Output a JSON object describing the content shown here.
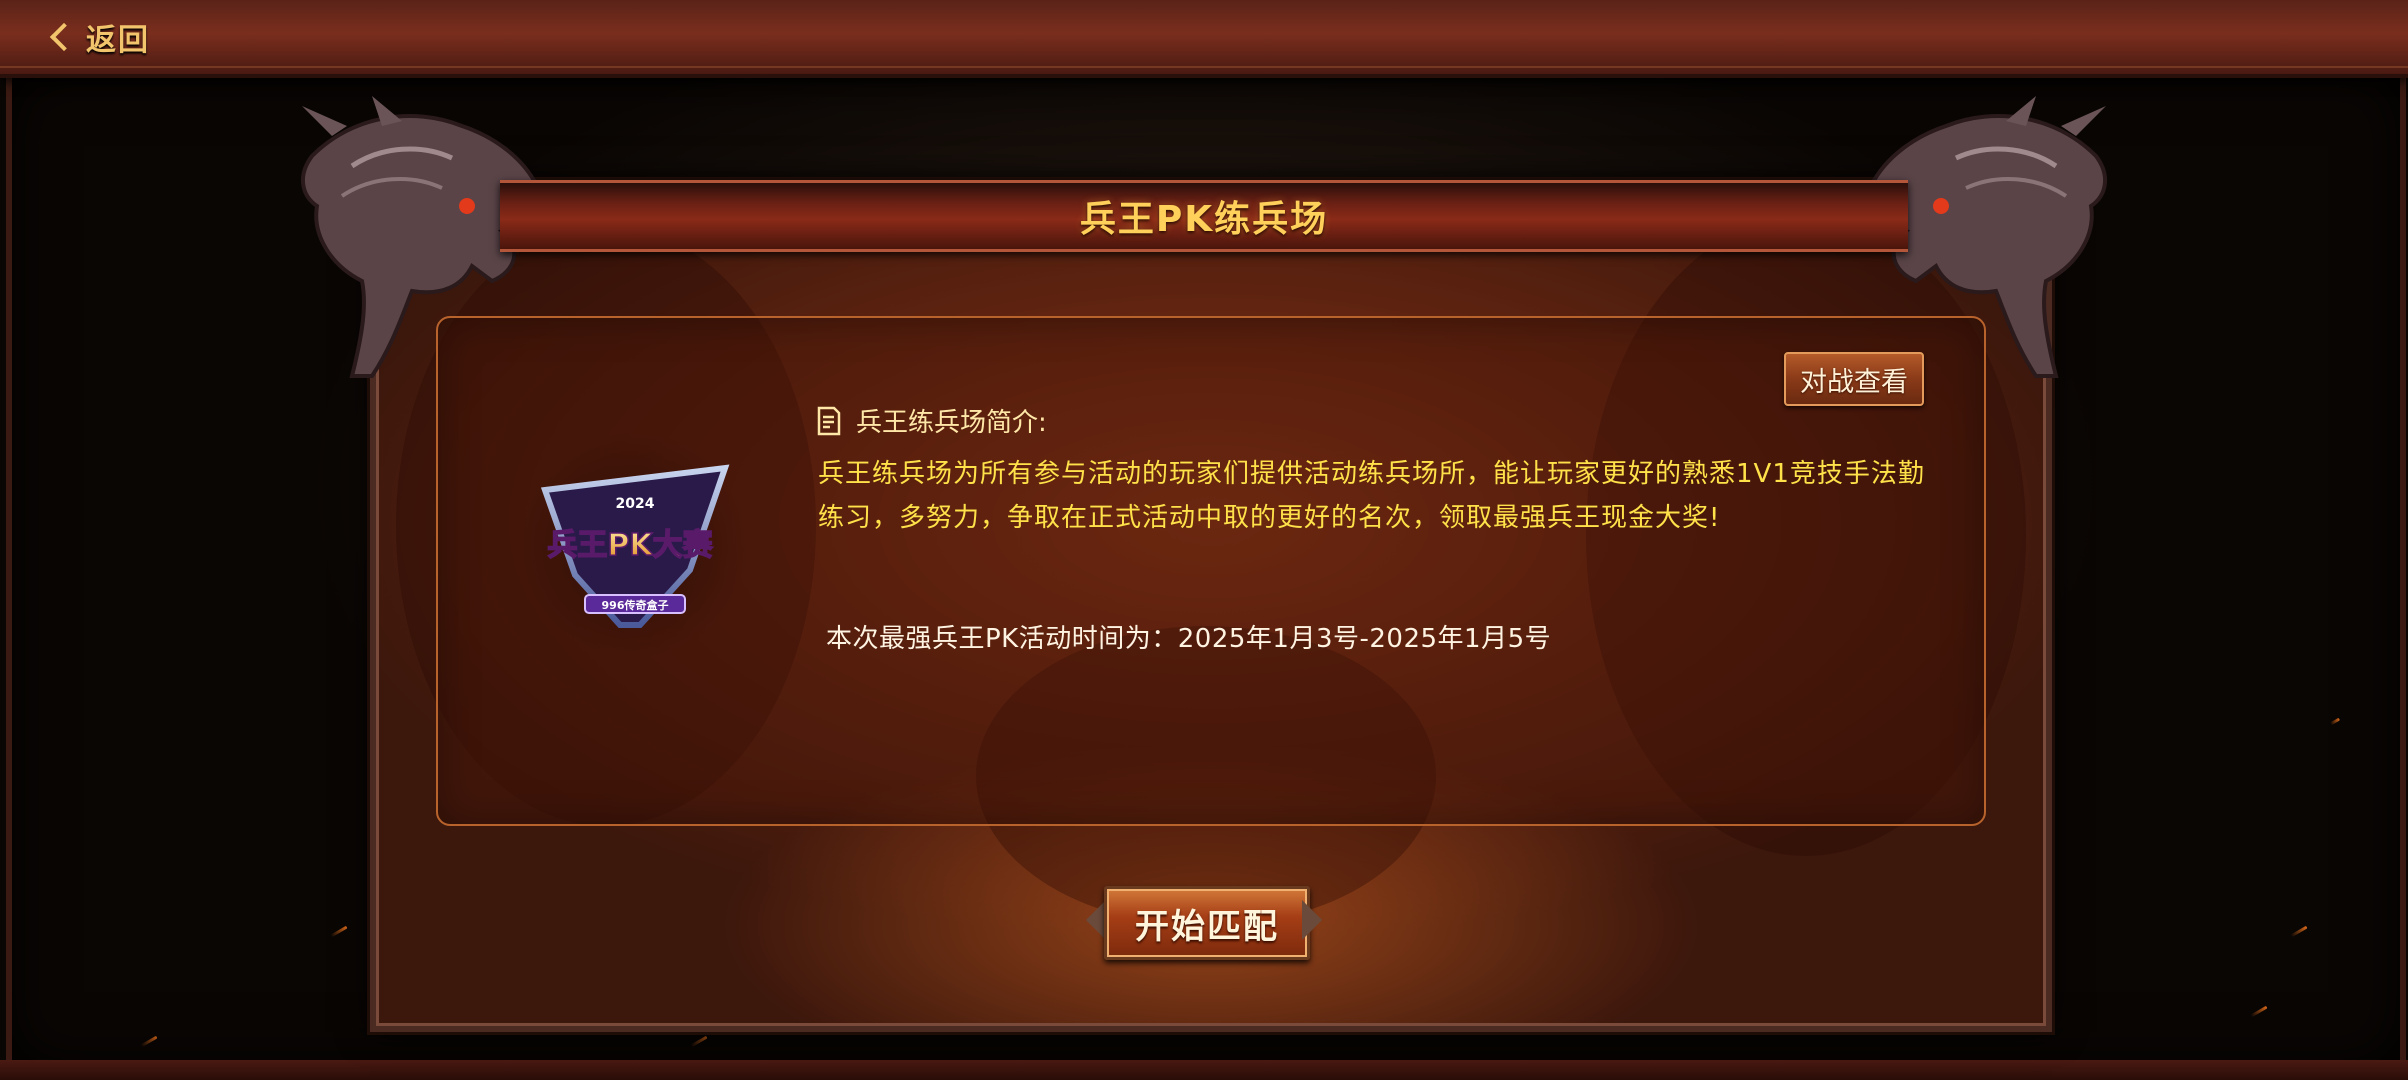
{
  "topbar": {
    "back_label": "返回"
  },
  "panel": {
    "title": "兵王PK练兵场",
    "vs_view_label": "对战查看",
    "intro_heading": "兵王练兵场简介:",
    "intro_text": "兵王练兵场为所有参与活动的玩家们提供活动练兵场所，能让玩家更好的熟悉1V1竞技手法勤练习，多努力，争取在正式活动中取的更好的名次，领取最强兵王现金大奖!",
    "event_time": "本次最强兵王PK活动时间为：2025年1月3号-2025年1月5号",
    "start_label": "开始匹配"
  },
  "logo": {
    "main_text": "兵王PK大赛",
    "year": "2024",
    "subtitle": "996传奇盒子"
  },
  "colors": {
    "title_gold": "#ffd15a",
    "intro_yellow": "#ffe14a",
    "button_orange": "#a63e16"
  },
  "icons": {
    "back": "chevron-left-icon",
    "intro": "document-icon",
    "dragons": "dragon-head-ornament"
  }
}
